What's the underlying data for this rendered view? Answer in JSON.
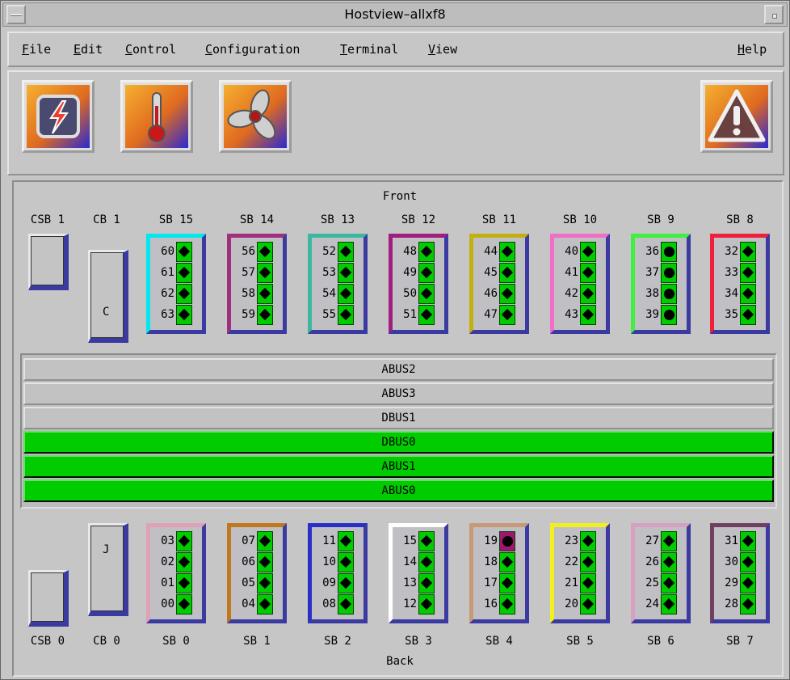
{
  "window": {
    "title": "Hostview–allxf8"
  },
  "menubar": {
    "items": [
      "File",
      "Edit",
      "Control",
      "Configuration",
      "Terminal",
      "View"
    ],
    "help": "Help"
  },
  "toolbar": {
    "buttons": [
      {
        "icon": "power-icon"
      },
      {
        "icon": "thermometer-icon"
      },
      {
        "icon": "fan-icon"
      },
      {
        "icon": "warning-icon"
      }
    ]
  },
  "panel": {
    "front_label": "Front",
    "back_label": "Back",
    "top_labels": {
      "csb1": "CSB 1",
      "cb1": "CB 1"
    },
    "bottom_labels": {
      "csb0": "CSB 0",
      "cb0": "CB 0"
    },
    "cb1_letter": "C",
    "cb0_letter": "J",
    "front_boards": [
      {
        "label": "SB 15",
        "color": "#00e8f0",
        "slots": [
          "60",
          "61",
          "62",
          "63"
        ],
        "status": [
          "ok",
          "ok",
          "ok",
          "ok"
        ]
      },
      {
        "label": "SB 14",
        "color": "#a0307e",
        "slots": [
          "56",
          "57",
          "58",
          "59"
        ],
        "status": [
          "ok",
          "ok",
          "ok",
          "ok"
        ]
      },
      {
        "label": "SB 13",
        "color": "#3cb8a0",
        "slots": [
          "52",
          "53",
          "54",
          "55"
        ],
        "status": [
          "ok",
          "ok",
          "ok",
          "ok"
        ]
      },
      {
        "label": "SB 12",
        "color": "#a01e80",
        "slots": [
          "48",
          "49",
          "50",
          "51"
        ],
        "status": [
          "ok",
          "ok",
          "ok",
          "ok"
        ]
      },
      {
        "label": "SB 11",
        "color": "#c0b010",
        "slots": [
          "44",
          "45",
          "46",
          "47"
        ],
        "status": [
          "ok",
          "ok",
          "ok",
          "ok"
        ]
      },
      {
        "label": "SB 10",
        "color": "#f06ec8",
        "slots": [
          "40",
          "41",
          "42",
          "43"
        ],
        "status": [
          "ok",
          "ok",
          "ok",
          "ok"
        ]
      },
      {
        "label": "SB 9",
        "color": "#40f040",
        "slots": [
          "36",
          "37",
          "38",
          "39"
        ],
        "status": [
          "offline",
          "offline",
          "offline",
          "offline"
        ]
      },
      {
        "label": "SB 8",
        "color": "#f0203c",
        "slots": [
          "32",
          "33",
          "34",
          "35"
        ],
        "status": [
          "ok",
          "ok",
          "ok",
          "ok"
        ]
      }
    ],
    "buses": [
      {
        "name": "ABUS2",
        "active": false
      },
      {
        "name": "ABUS3",
        "active": false
      },
      {
        "name": "DBUS1",
        "active": false
      },
      {
        "name": "DBUS0",
        "active": true
      },
      {
        "name": "ABUS1",
        "active": true
      },
      {
        "name": "ABUS0",
        "active": true
      }
    ],
    "back_boards": [
      {
        "label": "SB 0",
        "color": "#e0a0b8",
        "slots": [
          "03",
          "02",
          "01",
          "00"
        ],
        "status": [
          "ok",
          "ok",
          "ok",
          "ok"
        ]
      },
      {
        "label": "SB 1",
        "color": "#c07820",
        "slots": [
          "07",
          "06",
          "05",
          "04"
        ],
        "status": [
          "ok",
          "ok",
          "ok",
          "ok"
        ]
      },
      {
        "label": "SB 2",
        "color": "#2830c8",
        "slots": [
          "11",
          "10",
          "09",
          "08"
        ],
        "status": [
          "ok",
          "ok",
          "ok",
          "ok"
        ]
      },
      {
        "label": "SB 3",
        "color": "#ffffff",
        "slots": [
          "15",
          "14",
          "13",
          "12"
        ],
        "status": [
          "ok",
          "ok",
          "ok",
          "ok"
        ]
      },
      {
        "label": "SB 4",
        "color": "#c89878",
        "slots": [
          "19",
          "18",
          "17",
          "16"
        ],
        "status": [
          "faulty",
          "ok",
          "ok",
          "ok"
        ]
      },
      {
        "label": "SB 5",
        "color": "#f0f020",
        "slots": [
          "23",
          "22",
          "21",
          "20"
        ],
        "status": [
          "ok",
          "ok",
          "ok",
          "ok"
        ]
      },
      {
        "label": "SB 6",
        "color": "#d8a0c0",
        "slots": [
          "27",
          "26",
          "25",
          "24"
        ],
        "status": [
          "ok",
          "ok",
          "ok",
          "ok"
        ]
      },
      {
        "label": "SB 7",
        "color": "#704060",
        "slots": [
          "31",
          "30",
          "29",
          "28"
        ],
        "status": [
          "ok",
          "ok",
          "ok",
          "ok"
        ]
      }
    ]
  }
}
